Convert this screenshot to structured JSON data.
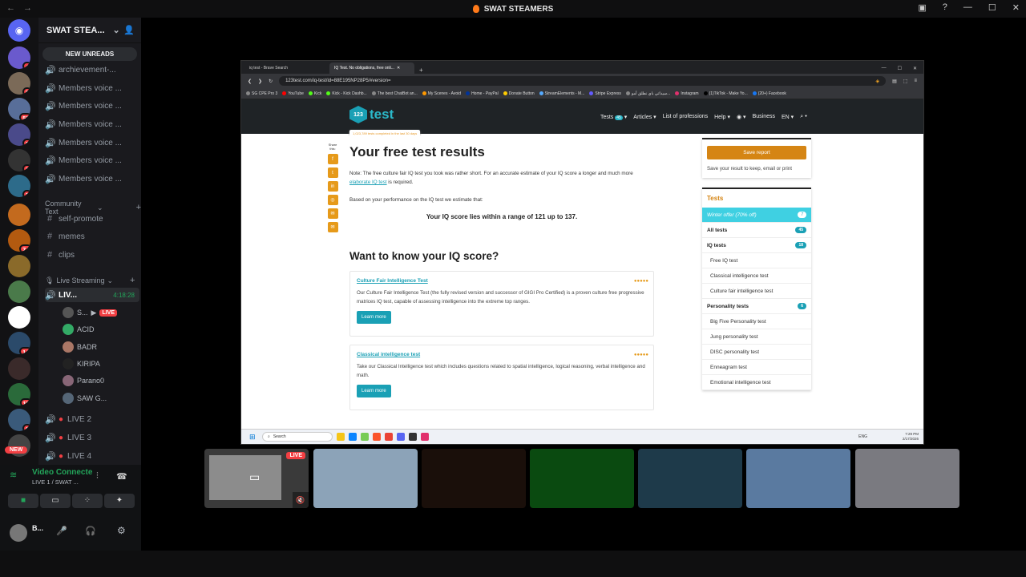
{
  "window": {
    "title": "SWAT STEAMERS"
  },
  "server": {
    "name": "SWAT STEA...",
    "new_unreads": "NEW UNREADS"
  },
  "channels": [
    {
      "name": "archievement-...",
      "type": "voice"
    },
    {
      "name": "Members voice ...",
      "type": "voice"
    },
    {
      "name": "Members voice ...",
      "type": "voice"
    },
    {
      "name": "Members voice ...",
      "type": "voice"
    },
    {
      "name": "Members voice ...",
      "type": "voice"
    },
    {
      "name": "Members voice ...",
      "type": "voice"
    },
    {
      "name": "Members voice ...",
      "type": "voice"
    }
  ],
  "community_category": "Community Text",
  "text_channels": [
    "self-promote",
    "memes",
    "clips"
  ],
  "live_category": "Live Streaming",
  "live_channel": {
    "name": "LIV...",
    "timer": "4:18:28"
  },
  "live_users": [
    {
      "name": "S...",
      "live": "LIVE"
    },
    {
      "name": "ACID"
    },
    {
      "name": "BADR"
    },
    {
      "name": "KIRIPA"
    },
    {
      "name": "Parano0"
    },
    {
      "name": "SAW G..."
    }
  ],
  "live_channels_more": [
    "LIVE 2",
    "LIVE 3",
    "LIVE 4"
  ],
  "server_badges": [
    "4",
    "2",
    "51",
    "3",
    "1",
    "3",
    "74",
    "14",
    "11",
    "6",
    "NEW"
  ],
  "voice_panel": {
    "status": "Video Connecte",
    "channel": "LIVE 1 / SWAT ...",
    "user": "B..."
  },
  "browser": {
    "tabs": [
      {
        "label": "iq test - Brave Search"
      },
      {
        "label": "IQ Test. No obligations, free onli..."
      }
    ],
    "url": "123test.com/iq-test/id=88E195NP28P5/#version=",
    "bookmarks": [
      "SG CPE Pro 3",
      "YouTube",
      "Kick",
      "Kick - Kick Dashb...",
      "The best ChatBot an...",
      "My Scenes - Avoid",
      "Home - PayPal",
      "Donate Button",
      "StreamElements - M...",
      "Stripe Express",
      "سيداتي باي نطلق أمو...",
      "Instagram",
      "(1)TikTok - Make Yo...",
      "(20+) Facebook"
    ]
  },
  "site": {
    "logo": "test",
    "completed": "1,023,789 tests completed in the last 30 days",
    "menu": {
      "tests": "Tests",
      "tests_count": "45",
      "articles": "Articles",
      "professions": "List of professions",
      "help": "Help",
      "business": "Business",
      "lang": "EN"
    },
    "share_label": "Share this:",
    "heading": "Your free test results",
    "note_pre": "Note: The free culture fair IQ test you took was rather short. For an accurate estimate of your IQ score a longer and much more ",
    "note_link": "elaborate IQ test",
    "note_post": " is required.",
    "based_on": "Based on your performance on the IQ test we estimate that:",
    "score_line": "Your IQ score lies within a range of 121 up to 137.",
    "subheading": "Want to know your IQ score?",
    "cards": [
      {
        "title": "Culture Fair Intelligence Test",
        "desc": "Our Culture Fair Intelligence Test (the fully revised version and successor of GIGI Pro Certified) is a proven culture free progressive matrices IQ test, capable of assessing intelligence into the extreme top ranges.",
        "button": "Learn more"
      },
      {
        "title": "Classical intelligence test",
        "desc": "Take our Classical Intelligence test which includes questions related to spatial intelligence, logical reasoning, verbal intelligence and math.",
        "button": "Learn more"
      }
    ],
    "save_button": "Save report",
    "save_text": "Save your result to keep, email or print",
    "tests_heading": "Tests",
    "tests_offer": {
      "label": "Winter offer (70% off)",
      "count": "7"
    },
    "tests_list": [
      {
        "label": "All tests",
        "count": "45",
        "bold": true
      },
      {
        "label": "IQ tests",
        "count": "18",
        "bold": true
      },
      {
        "label": "Free IQ test"
      },
      {
        "label": "Classical intelligence test"
      },
      {
        "label": "Culture fair intelligence test"
      },
      {
        "label": "Personality tests",
        "count": "6",
        "bold": true
      },
      {
        "label": "Big Five Personality test"
      },
      {
        "label": "Jung personality test"
      },
      {
        "label": "DISC personality test"
      },
      {
        "label": "Enneagram test"
      },
      {
        "label": "Emotional intelligence test"
      }
    ]
  },
  "taskbar": {
    "search": "Search",
    "lang": "ENG",
    "time": "7:29 PM",
    "date": "2/17/2026"
  },
  "stream_live": "LIVE"
}
